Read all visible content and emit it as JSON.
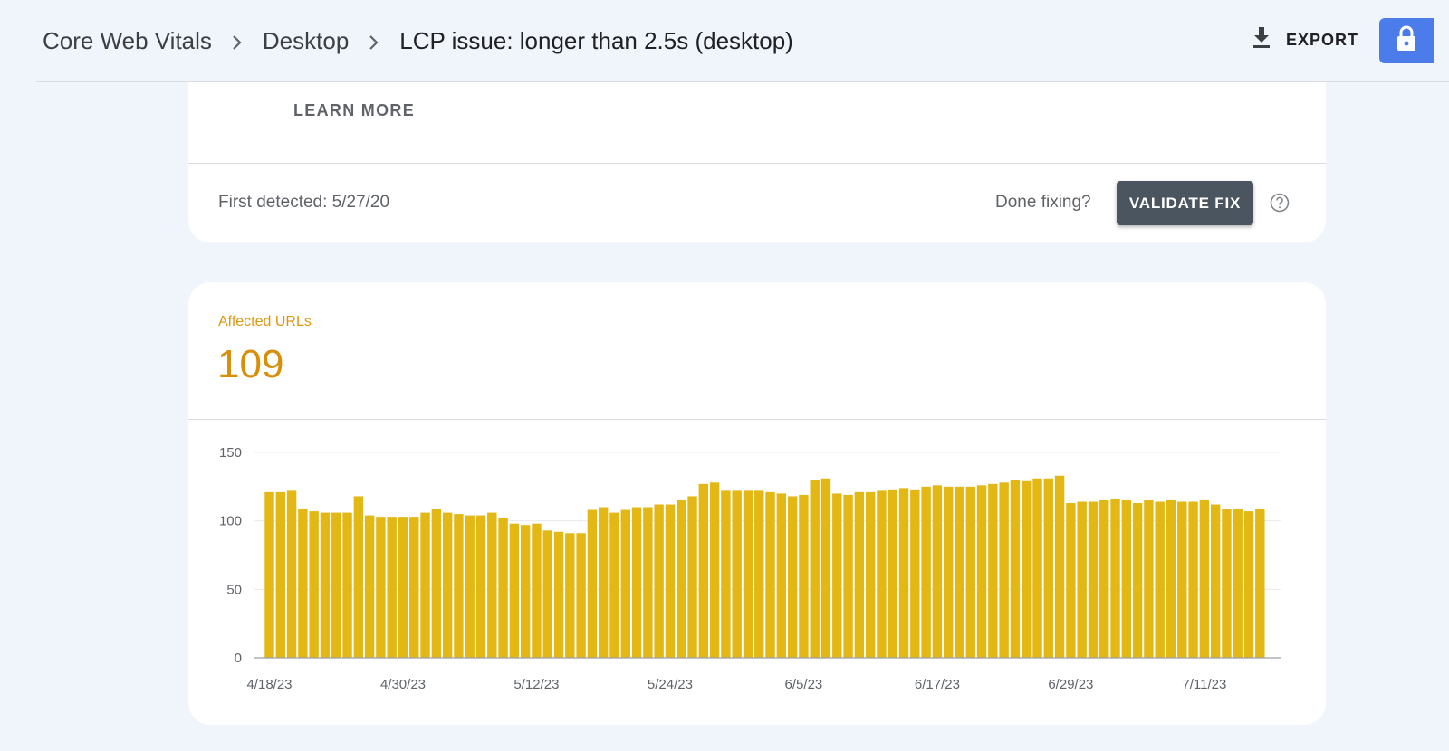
{
  "header": {
    "breadcrumbs": [
      "Core Web Vitals",
      "Desktop",
      "LCP issue: longer than 2.5s (desktop)"
    ],
    "export_label": "EXPORT",
    "export_icon": "download-icon",
    "lock_icon": "lock-icon"
  },
  "issue_card": {
    "learn_more_label": "LEARN MORE",
    "first_detected": "First detected: 5/27/20",
    "done_fixing": "Done fixing?",
    "validate_label": "VALIDATE FIX",
    "help_icon": "help-circle-icon"
  },
  "metric": {
    "label": "Affected URLs",
    "value": "109"
  },
  "colors": {
    "accent": "#e0960b",
    "bar": "#e3b714",
    "validate_button": "#4a555f",
    "lock_button": "#4c7ce9"
  },
  "chart_data": {
    "type": "bar",
    "title": "",
    "xlabel": "",
    "ylabel": "",
    "ylim": [
      0,
      150
    ],
    "yticks": [
      0,
      50,
      100,
      150
    ],
    "x_tick_labels": [
      "4/18/23",
      "4/30/23",
      "5/12/23",
      "5/24/23",
      "6/5/23",
      "6/17/23",
      "6/29/23",
      "7/11/23"
    ],
    "x_start": "4/18/23",
    "x_tick_every_days": 12,
    "grid": true,
    "legend": "none",
    "values": [
      121,
      121,
      122,
      109,
      107,
      106,
      106,
      106,
      118,
      104,
      103,
      103,
      103,
      103,
      106,
      109,
      106,
      105,
      104,
      104,
      106,
      102,
      98,
      97,
      98,
      93,
      92,
      91,
      91,
      108,
      110,
      106,
      108,
      110,
      110,
      112,
      112,
      115,
      118,
      127,
      128,
      122,
      122,
      122,
      122,
      121,
      120,
      118,
      119,
      130,
      131,
      120,
      119,
      121,
      121,
      122,
      123,
      124,
      123,
      125,
      126,
      125,
      125,
      125,
      126,
      127,
      128,
      130,
      129,
      131,
      131,
      133,
      113,
      114,
      114,
      115,
      116,
      115,
      113,
      115,
      114,
      115,
      114,
      114,
      115,
      112,
      109,
      109,
      107,
      109
    ]
  }
}
